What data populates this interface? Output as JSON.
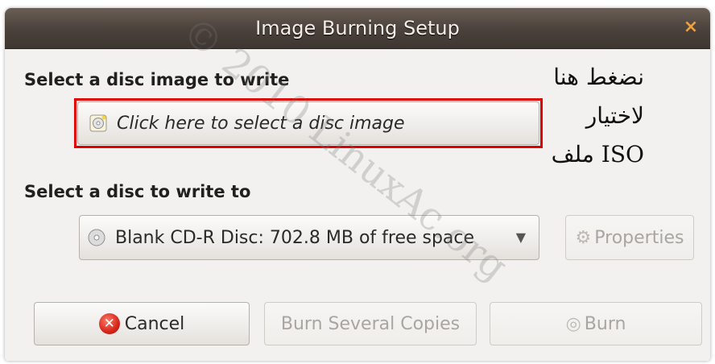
{
  "window": {
    "title": "Image Burning Setup",
    "close_icon": "close-icon"
  },
  "image_section": {
    "heading": "Select a disc image to write",
    "chooser_label": "Click here to select a disc image",
    "chooser_icon": "disc-image-icon"
  },
  "disc_section": {
    "heading": "Select a disc to write to",
    "selected_disc": "Blank CD-R Disc: 702.8 MB of free space",
    "disc_icon": "cd-icon",
    "properties_label": "Properties"
  },
  "buttons": {
    "cancel": "Cancel",
    "burn_several": "Burn Several Copies",
    "burn": "Burn"
  },
  "annotation": {
    "line1": "نضغط هنا",
    "line2": "لاختيار",
    "line3": "ملف ISO"
  },
  "watermark": "© 2010 LinuxAc.org",
  "colors": {
    "highlight_frame": "#e10000",
    "titlebar": "#4a413b",
    "close_accent": "#f0a33c"
  }
}
